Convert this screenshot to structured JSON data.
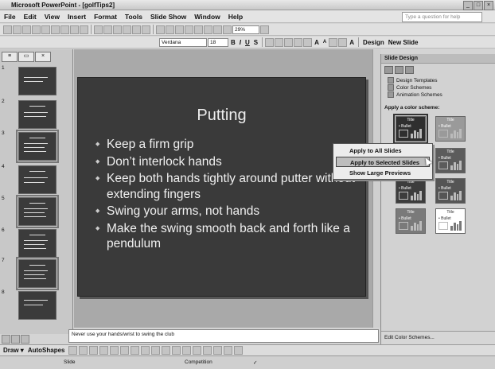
{
  "window": {
    "title": "Microsoft PowerPoint - [golfTips2]"
  },
  "menu": {
    "items": [
      "File",
      "Edit",
      "View",
      "Insert",
      "Format",
      "Tools",
      "Slide Show",
      "Window",
      "Help"
    ],
    "ask_placeholder": "Type a question for help"
  },
  "toolbar": {
    "zoom": "29%"
  },
  "formatting": {
    "font": "Verdana",
    "size": "18",
    "design_label": "Design",
    "new_slide_label": "New Slide"
  },
  "thumbnails": [
    "1",
    "2",
    "3",
    "4",
    "5",
    "6",
    "7",
    "8"
  ],
  "slide": {
    "title": "Putting",
    "bullets": [
      "Keep a firm grip",
      "Don’t interlock hands",
      "Keep both hands tightly around putter without extending fingers",
      "Swing your arms, not hands",
      "Make the swing smooth back and forth like a pendulum"
    ]
  },
  "notes": {
    "text": "Never use your hands/wrist to swing the club"
  },
  "task_pane": {
    "title": "Slide Design",
    "links": [
      "Design Templates",
      "Color Schemes",
      "Animation Schemes"
    ],
    "apply_heading": "Apply a color scheme:",
    "bottom_link": "Edit Color Schemes...",
    "scheme_title": "Title",
    "scheme_bullet": "• Bullet",
    "scheme_colors": [
      "#2f2f2f",
      "#9a9a9a",
      "#4a4a4a",
      "#5c5c5c",
      "#3d3d3d",
      "#555555",
      "#7a7a7a",
      "#ffffff"
    ]
  },
  "context_menu": {
    "items": [
      "Apply to All Slides",
      "Apply to Selected Slides",
      "Show Large Previews"
    ],
    "highlighted": "Apply to Selected Slides"
  },
  "drawing_toolbar": {
    "autoshapes": "AutoShapes"
  },
  "status": {
    "left": "Slide",
    "design": "Competition"
  }
}
